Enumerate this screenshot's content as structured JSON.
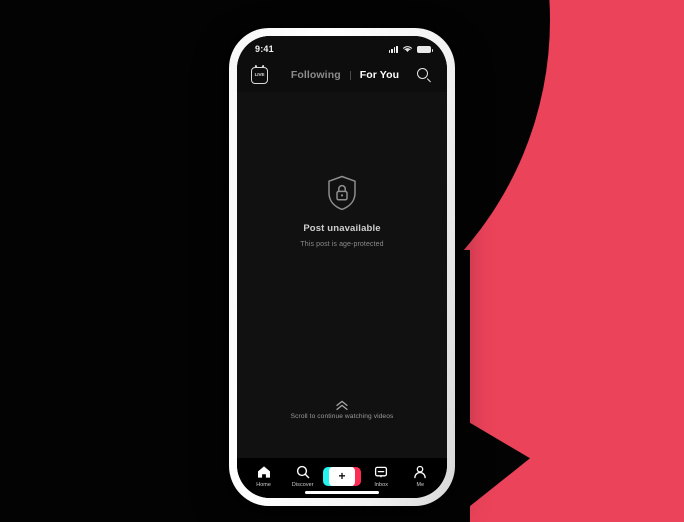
{
  "background": {
    "cyan": "#69EFE4",
    "pink": "#EA435A",
    "black": "#030303"
  },
  "phone": {
    "frame_color": "#f2f2f2",
    "screen_color": "#111111"
  },
  "status_bar": {
    "time": "9:41",
    "signal_icon": "cellular-signal-icon",
    "wifi_icon": "wifi-icon",
    "battery_icon": "battery-icon"
  },
  "top_nav": {
    "live_button": {
      "label": "LIVE",
      "icon": "live-icon"
    },
    "tabs": [
      {
        "label": "Following",
        "active": false
      },
      {
        "label": "For You",
        "active": true
      }
    ],
    "search_icon": "search-icon"
  },
  "content": {
    "shield_icon": "shield-lock-icon",
    "title": "Post unavailable",
    "subtitle": "This post is age-protected"
  },
  "scroll_hint": {
    "icon": "double-chevron-up-icon",
    "label": "Scroll to continue watching videos"
  },
  "tab_bar": {
    "items": [
      {
        "label": "Home",
        "icon": "home-icon"
      },
      {
        "label": "Discover",
        "icon": "search-icon"
      },
      {
        "label": "",
        "icon": "plus-icon"
      },
      {
        "label": "Inbox",
        "icon": "inbox-icon"
      },
      {
        "label": "Me",
        "icon": "person-icon"
      }
    ],
    "create_button": {
      "glyph": "+",
      "left_color": "#25F4EE",
      "right_color": "#FE2C55"
    }
  }
}
